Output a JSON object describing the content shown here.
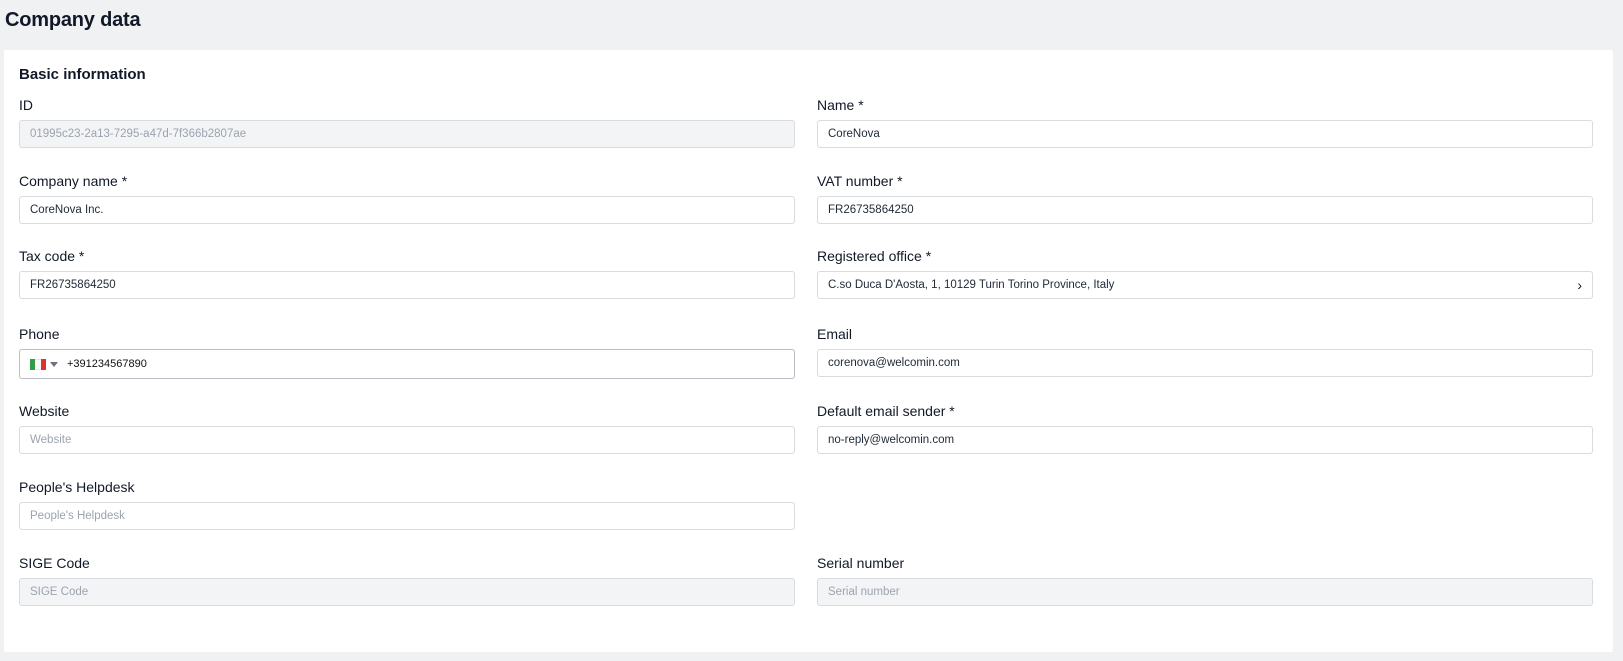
{
  "page": {
    "title": "Company data"
  },
  "section": {
    "title": "Basic information"
  },
  "fields": {
    "id": {
      "label": "ID",
      "value": "01995c23-2a13-7295-a47d-7f366b2807ae"
    },
    "name": {
      "label": "Name *",
      "value": "CoreNova"
    },
    "company_name": {
      "label": "Company name *",
      "value": "CoreNova Inc."
    },
    "vat_number": {
      "label": "VAT number *",
      "value": "FR26735864250"
    },
    "tax_code": {
      "label": "Tax code *",
      "value": "FR26735864250"
    },
    "registered_office": {
      "label": "Registered office *",
      "value": "C.so Duca D'Aosta, 1, 10129 Turin Torino Province, Italy",
      "icon": "chevron-right-icon"
    },
    "phone": {
      "label": "Phone",
      "country_flag": "italy-flag-icon",
      "value": "+391234567890"
    },
    "email": {
      "label": "Email",
      "value": "corenova@welcomin.com"
    },
    "website": {
      "label": "Website",
      "placeholder": "Website"
    },
    "default_email_sender": {
      "label": "Default email sender *",
      "value": "no-reply@welcomin.com"
    },
    "peoples_helpdesk": {
      "label": "People's Helpdesk",
      "placeholder": "People's Helpdesk"
    },
    "sige_code": {
      "label": "SIGE Code",
      "placeholder": "SIGE Code"
    },
    "serial_number": {
      "label": "Serial number",
      "placeholder": "Serial number"
    }
  },
  "colors": {
    "page_bg": "#f0f1f3",
    "card_bg": "#ffffff",
    "border": "#d8dbe0",
    "disabled_bg": "#f3f4f6",
    "placeholder": "#9ca3af"
  }
}
